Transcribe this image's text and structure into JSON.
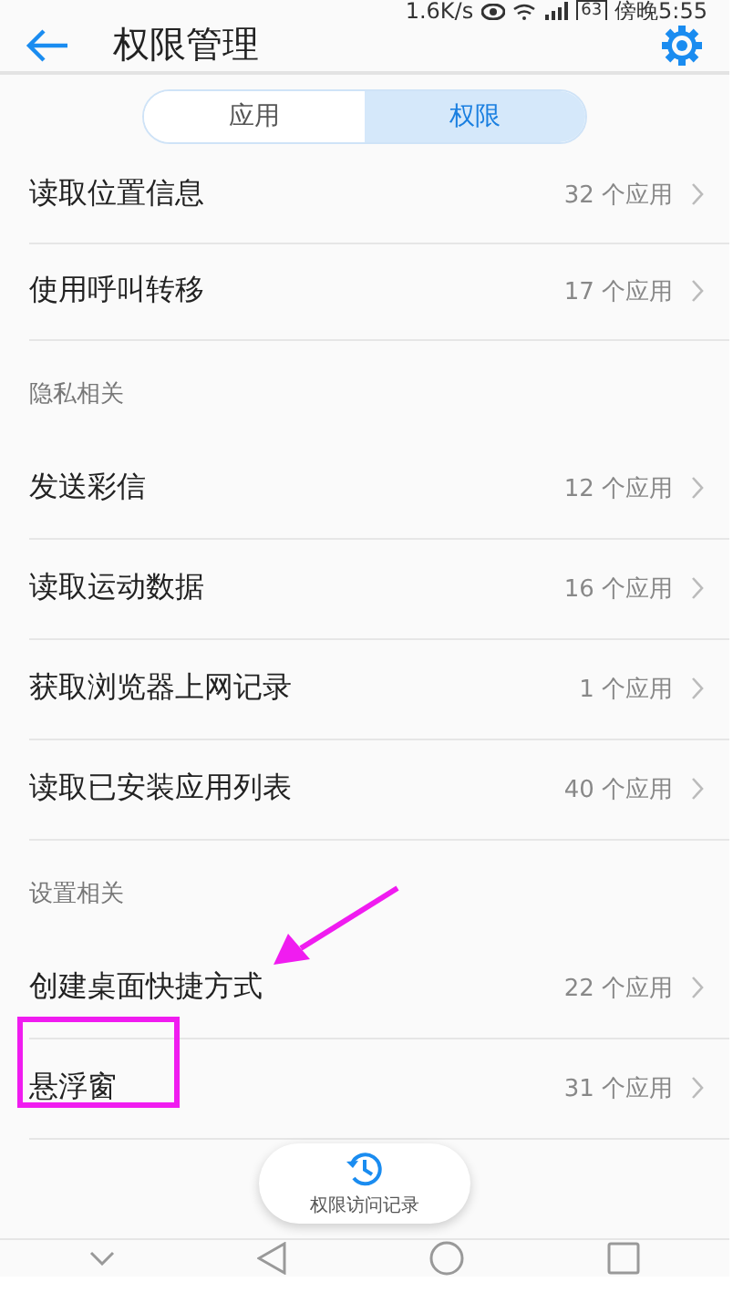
{
  "status_bar": {
    "speed": "1.6K/s",
    "battery": "63",
    "time": "傍晚5:55"
  },
  "header": {
    "title": "权限管理"
  },
  "tabs": [
    {
      "label": "应用",
      "selected": false
    },
    {
      "label": "权限",
      "selected": true
    }
  ],
  "sections": [
    {
      "items": [
        {
          "label": "读取位置信息",
          "count": "32 个应用"
        },
        {
          "label": "使用呼叫转移",
          "count": "17 个应用"
        }
      ]
    },
    {
      "title": "隐私相关",
      "items": [
        {
          "label": "发送彩信",
          "count": "12 个应用"
        },
        {
          "label": "读取运动数据",
          "count": "16 个应用"
        },
        {
          "label": "获取浏览器上网记录",
          "count": "1 个应用"
        },
        {
          "label": "读取已安装应用列表",
          "count": "40 个应用"
        }
      ]
    },
    {
      "title": "设置相关",
      "items": [
        {
          "label": "创建桌面快捷方式",
          "count": "22 个应用"
        },
        {
          "label": "悬浮窗",
          "count": "31 个应用"
        }
      ]
    }
  ],
  "history_button": {
    "label": "权限访问记录"
  }
}
